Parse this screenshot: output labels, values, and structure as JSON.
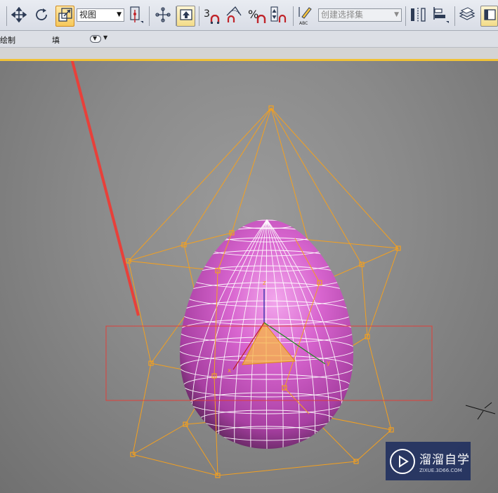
{
  "toolbar": {
    "view_dropdown": "视图",
    "snap_number": "3",
    "percent_symbol": "%",
    "abc_label": "ABC",
    "selection_set_placeholder": "创建选择集"
  },
  "menubar": {
    "items": [
      "绘制",
      "填"
    ]
  },
  "watermark": {
    "title": "溜溜自学",
    "url": "ZIXUE.3D66.COM"
  },
  "colors": {
    "egg": "#c94fc2",
    "wireframe": "#f3a020",
    "selection_rect": "#e0403a",
    "arrow": "#e8403a",
    "viewport_border": "#f0c237"
  }
}
